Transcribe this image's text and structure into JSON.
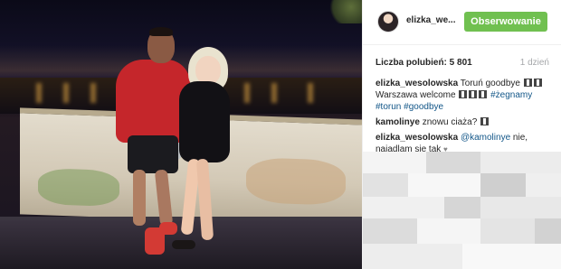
{
  "post": {
    "username": "elizka_we...",
    "follow_label": "Obserwowanie",
    "likes_text": "Liczba polubień: 5 801",
    "time_ago": "1 dzień"
  },
  "comments": [
    {
      "user": "elizka_wesolowska",
      "text_before": "Toruń goodbye",
      "text_mid": "Warszawa welcome",
      "hashtags": [
        "#żegnamy",
        "#torun",
        "#goodbye"
      ]
    },
    {
      "user": "kamolinye",
      "text": "znowu ciaża?"
    },
    {
      "user": "elizka_wesolowska",
      "mention": "@kamolinye",
      "text": "nie, najadlam się tak"
    }
  ],
  "colors": {
    "follow_button": "#70c050",
    "link": "#125688",
    "muted": "#a5a7aa",
    "text": "#262626"
  },
  "icons": {
    "emoji": "face-emoji-icon"
  }
}
